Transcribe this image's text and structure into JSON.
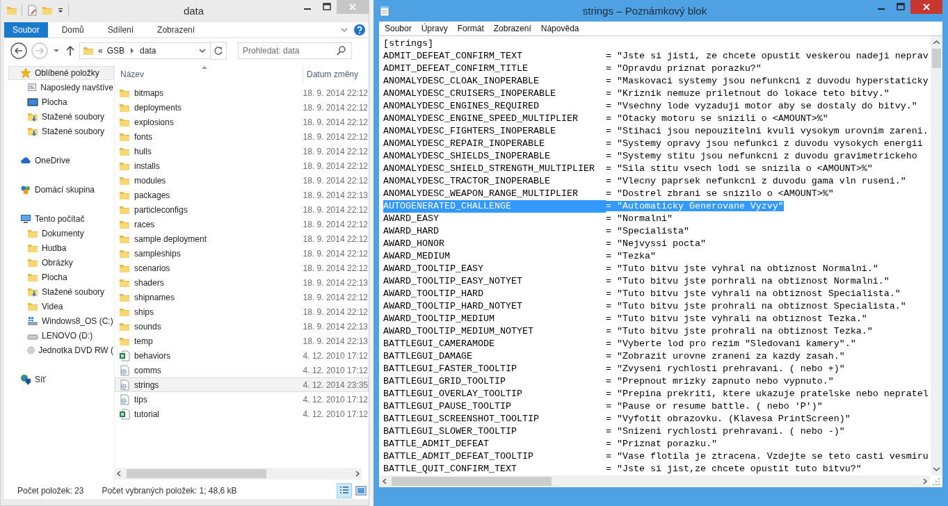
{
  "explorer": {
    "title": "data",
    "ribbon_tabs": [
      {
        "label": "Soubor",
        "kind": "file"
      },
      {
        "label": "Domů",
        "kind": "tab"
      },
      {
        "label": "Sdílení",
        "kind": "tab"
      },
      {
        "label": "Zobrazení",
        "kind": "tab"
      }
    ],
    "address": {
      "overflow": "«",
      "crumbs": [
        "GSB",
        "data"
      ]
    },
    "search": {
      "placeholder": "Prohledat: data"
    },
    "nav": [
      {
        "label": "Oblíbené položky",
        "kind": "star",
        "selected": true,
        "children": [
          {
            "label": "Naposledy navštíve",
            "kind": "recent",
            "selected": false
          },
          {
            "label": "Plocha",
            "kind": "desktop",
            "selected": false
          },
          {
            "label": "Stažené soubory",
            "kind": "downloads",
            "selected": false
          },
          {
            "label": "Stažené soubory",
            "kind": "downloads",
            "selected": false
          }
        ]
      },
      {
        "label": "OneDrive",
        "kind": "cloud",
        "selected": false
      },
      {
        "label": "Domácí skupina",
        "kind": "homegroup",
        "selected": false
      },
      {
        "label": "Tento počítač",
        "kind": "computer",
        "selected": false,
        "children": [
          {
            "label": "Dokumenty",
            "kind": "folder",
            "selected": false
          },
          {
            "label": "Hudba",
            "kind": "folder",
            "selected": false
          },
          {
            "label": "Obrázky",
            "kind": "folder",
            "selected": false
          },
          {
            "label": "Plocha",
            "kind": "folder",
            "selected": false
          },
          {
            "label": "Stažené soubory",
            "kind": "downloads",
            "selected": false
          },
          {
            "label": "Videa",
            "kind": "folder",
            "selected": false
          },
          {
            "label": "Windows8_OS (C:)",
            "kind": "system-drive",
            "selected": false
          },
          {
            "label": "LENOVO (D:)",
            "kind": "drive",
            "selected": false
          },
          {
            "label": "Jednotka DVD RW (",
            "kind": "dvd",
            "selected": false
          }
        ]
      },
      {
        "label": "Síť",
        "kind": "network",
        "selected": false
      }
    ],
    "columns": [
      "Název",
      "Datum změny"
    ],
    "files": [
      {
        "name": "bitmaps",
        "kind": "folder",
        "modified": "18. 9. 2014 22:12",
        "selected": false
      },
      {
        "name": "deployments",
        "kind": "folder",
        "modified": "18. 9. 2014 22:12",
        "selected": false
      },
      {
        "name": "explosions",
        "kind": "folder",
        "modified": "18. 9. 2014 22:12",
        "selected": false
      },
      {
        "name": "fonts",
        "kind": "folder",
        "modified": "18. 9. 2014 22:12",
        "selected": false
      },
      {
        "name": "hulls",
        "kind": "folder",
        "modified": "18. 9. 2014 22:12",
        "selected": false
      },
      {
        "name": "installs",
        "kind": "folder",
        "modified": "18. 9. 2014 22:12",
        "selected": false
      },
      {
        "name": "modules",
        "kind": "folder",
        "modified": "18. 9. 2014 22:12",
        "selected": false
      },
      {
        "name": "packages",
        "kind": "folder",
        "modified": "18. 9. 2014 22:13",
        "selected": false
      },
      {
        "name": "particleconfigs",
        "kind": "folder",
        "modified": "18. 9. 2014 22:12",
        "selected": false
      },
      {
        "name": "races",
        "kind": "folder",
        "modified": "18. 9. 2014 22:12",
        "selected": false
      },
      {
        "name": "sample deployment",
        "kind": "folder",
        "modified": "18. 9. 2014 22:12",
        "selected": false
      },
      {
        "name": "sampleships",
        "kind": "folder",
        "modified": "18. 9. 2014 22:12",
        "selected": false
      },
      {
        "name": "scenarios",
        "kind": "folder",
        "modified": "18. 9. 2014 22:12",
        "selected": false
      },
      {
        "name": "shaders",
        "kind": "folder",
        "modified": "18. 9. 2014 22:13",
        "selected": false
      },
      {
        "name": "shipnames",
        "kind": "folder",
        "modified": "18. 9. 2014 22:12",
        "selected": false
      },
      {
        "name": "ships",
        "kind": "folder",
        "modified": "18. 9. 2014 22:12",
        "selected": false
      },
      {
        "name": "sounds",
        "kind": "folder",
        "modified": "18. 9. 2014 22:13",
        "selected": false
      },
      {
        "name": "temp",
        "kind": "folder",
        "modified": "18. 9. 2014 22:13",
        "selected": false
      },
      {
        "name": "behaviors",
        "kind": "spreadsheet",
        "modified": "4. 12. 2010 17:12",
        "selected": false
      },
      {
        "name": "comms",
        "kind": "config",
        "modified": "4. 12. 2010 17:12",
        "selected": false
      },
      {
        "name": "strings",
        "kind": "config",
        "modified": "4. 12. 2014 23:35",
        "selected": true
      },
      {
        "name": "tips",
        "kind": "config",
        "modified": "4. 12. 2010 17:12",
        "selected": false
      },
      {
        "name": "tutorial",
        "kind": "spreadsheet",
        "modified": "4. 12. 2010 17:12",
        "selected": false
      }
    ],
    "status": {
      "count": "Počet položek: 23",
      "selection": "Počet vybraných položek: 1; 48,6 kB"
    }
  },
  "notepad": {
    "title": "strings – Poznámkový blok",
    "menu": [
      "Soubor",
      "Úpravy",
      "Formát",
      "Zobrazení",
      "Nápověda"
    ],
    "lines": [
      {
        "key": "[strings]",
        "selected": false
      },
      {
        "key": "ADMIT_DEFEAT_CONFIRM_TEXT",
        "value": "= \"Jste si jisti, ze chcete opustit veskerou nadeji neprav",
        "selected": false
      },
      {
        "key": "ADMIT_DEFEAT_CONFIRM_TITLE",
        "value": "= \"Opravdu priznat porazku?\"",
        "selected": false
      },
      {
        "key": "ANOMALYDESC_CLOAK_INOPERABLE",
        "value": "= \"Maskovaci systemy jsou nefunkcni z duvodu hyperstaticky",
        "selected": false
      },
      {
        "key": "ANOMALYDESC_CRUISERS_INOPERABLE",
        "value": "= \"Kriznik nemuze priletnout do lokace teto bitvy.\"",
        "selected": false
      },
      {
        "key": "ANOMALYDESC_ENGINES_REQUIRED",
        "value": "= \"Vsechny lode vyzaduji motor aby se dostaly do bitvy.\"",
        "selected": false
      },
      {
        "key": "ANOMALYDESC_ENGINE_SPEED_MULTIPLIER",
        "value": "= \"Otacky motoru se snizili o <AMOUNT>%\"",
        "selected": false
      },
      {
        "key": "ANOMALYDESC_FIGHTERS_INOPERABLE",
        "value": "= \"Stihaci jsou nepouzitelni kvuli vysokym urovnim zareni.",
        "selected": false
      },
      {
        "key": "ANOMALYDESC_REPAIR_INOPERABLE",
        "value": "= \"Systemy opravy jsou nefunkci z duvodu vysokych energii",
        "selected": false
      },
      {
        "key": "ANOMALYDESC_SHIELDS_INOPERABLE",
        "value": "= \"Systemy stitu jsou nefunkcni z duvodu gravimetrickeho",
        "selected": false
      },
      {
        "key": "ANOMALYDESC_SHIELD_STRENGTH_MULTIPLIER",
        "value": "= \"Sila stitu vsech lodi se snizila o <AMOUNT>%\"",
        "selected": false
      },
      {
        "key": "ANOMALYDESC_TRACTOR_INOPERABLE",
        "value": "= \"Vlecny paprsek nefunkcni z duvodu gama vln ruseni.\"",
        "selected": false
      },
      {
        "key": "ANOMALYDESC_WEAPON_RANGE_MULTIPLIER",
        "value": "= \"Dostrel zbrani se snizilo o <AMOUNT>%\"",
        "selected": false
      },
      {
        "key": "AUTOGENERATED_CHALLENGE",
        "value": "= \"Automaticky Generovane Vyzvy\"",
        "selected": true
      },
      {
        "key": "AWARD_EASY",
        "value": "= \"Normalni\"",
        "selected": false
      },
      {
        "key": "AWARD_HARD",
        "value": "= \"Specialista\"",
        "selected": false
      },
      {
        "key": "AWARD_HONOR",
        "value": "= \"Nejvyssi pocta\"",
        "selected": false
      },
      {
        "key": "AWARD_MEDIUM",
        "value": "= \"Tezka\"",
        "selected": false
      },
      {
        "key": "AWARD_TOOLTIP_EASY",
        "value": "= \"Tuto bitvu jste vyhral na obtiznost Normalni.\"",
        "selected": false
      },
      {
        "key": "AWARD_TOOLTIP_EASY_NOTYET",
        "value": "= \"Tuto bitvu jste porhrali na obtiznost Normalni.\"",
        "selected": false
      },
      {
        "key": "AWARD_TOOLTIP_HARD",
        "value": "= \"Tuto bitvu jste vyhrali na obtiznost Specialista.\"",
        "selected": false
      },
      {
        "key": "AWARD_TOOLTIP_HARD_NOTYET",
        "value": "= \"Tuto bitvu jste prohrali na obtiznost Specialista.\"",
        "selected": false
      },
      {
        "key": "AWARD_TOOLTIP_MEDIUM",
        "value": "= \"Tuto bitvu jste vyhrali na obtiznost Tezka.\"",
        "selected": false
      },
      {
        "key": "AWARD_TOOLTIP_MEDIUM_NOTYET",
        "value": "= \"Tuto bitvu jste prohrali na obtiznost Tezka.\"",
        "selected": false
      },
      {
        "key": "BATTLEGUI_CAMERAMODE",
        "value": "= \"Vyberte lod pro rezim \"Sledovani kamery\".\"",
        "selected": false
      },
      {
        "key": "BATTLEGUI_DAMAGE",
        "value": "= \"Zobrazit urovne zraneni za kazdy zasah.\"",
        "selected": false
      },
      {
        "key": "BATTLEGUI_FASTER_TOOLTIP",
        "value": "= \"Zvyseni rychlosti prehravani. ( nebo +)\"",
        "selected": false
      },
      {
        "key": "BATTLEGUI_GRID_TOOLTIP",
        "value": "= \"Prepnout mrizky zapnuto nebo vypnuto.\"",
        "selected": false
      },
      {
        "key": "BATTLEGUI_OVERLAY_TOOLTIP",
        "value": "= \"Prepina prekriti, ktere ukazuje pratelske nebo nepratel",
        "selected": false
      },
      {
        "key": "BATTLEGUI_PAUSE_TOOLTIP",
        "value": "= \"Pause or resume battle. ( nebo 'P')\"",
        "selected": false
      },
      {
        "key": "BATTLEGUI_SCREENSHOT_TOOLTIP",
        "value": "= \"Vyfotit obrazovku. (Klavesa PrintScreen)\"",
        "selected": false
      },
      {
        "key": "BATTLEGUI_SLOWER_TOOLTIP",
        "value": "= \"Snizeni rychlosti prehravani. ( nebo -)\"",
        "selected": false
      },
      {
        "key": "BATTLE_ADMIT_DEFEAT",
        "value": "= \"Priznat porazku.\"",
        "selected": false
      },
      {
        "key": "BATTLE_ADMIT_DEFEAT_TOOLTIP",
        "value": "= \"Vase flotila je ztracena. Vzdejte se teto casti vesmiru",
        "selected": false
      },
      {
        "key": "BATTLE_QUIT_CONFIRM_TEXT",
        "value": "= \"Jste si jist,ze chcete opustit tuto bitvu?\"",
        "selected": false
      }
    ]
  }
}
